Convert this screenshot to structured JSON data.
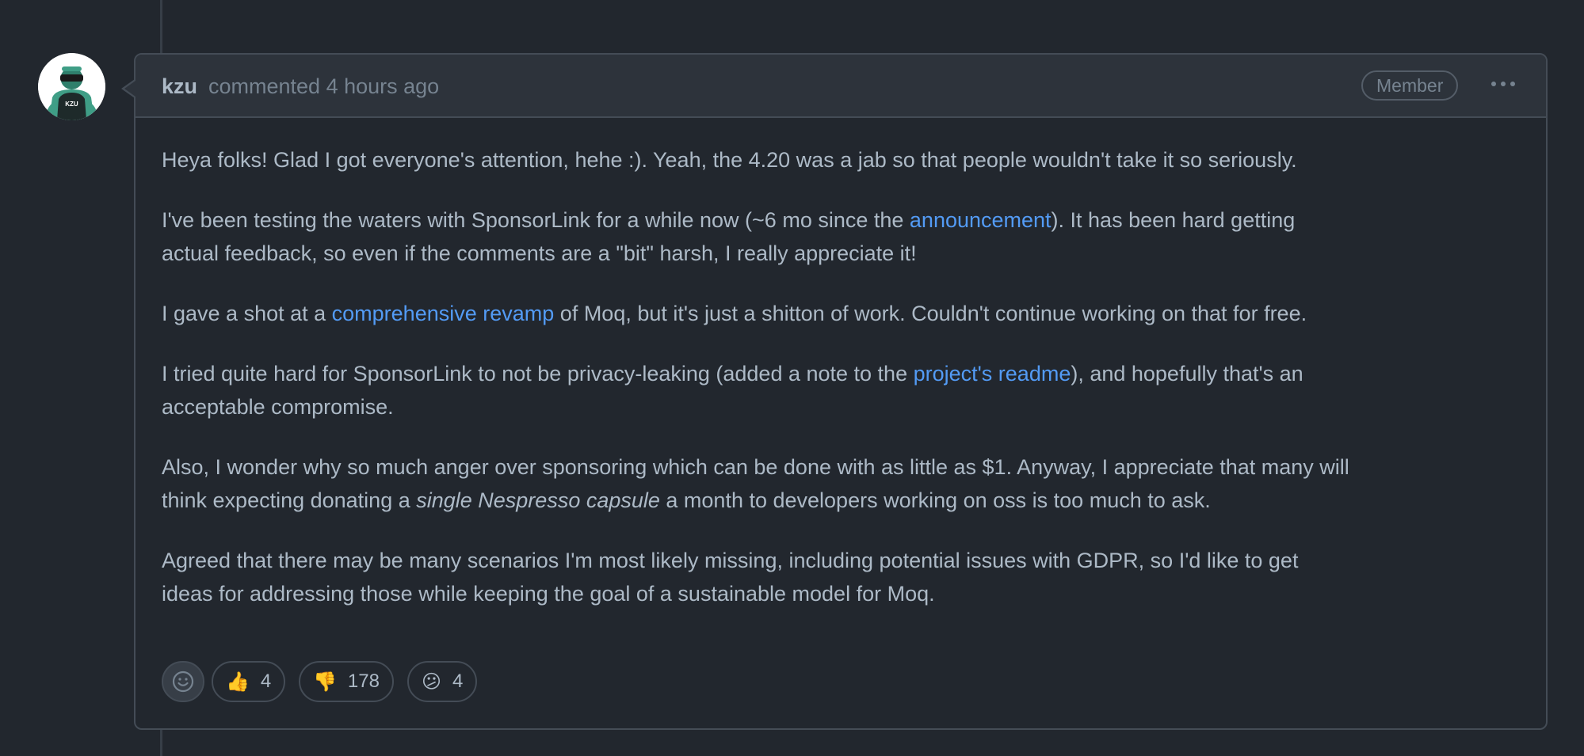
{
  "comment": {
    "author": "kzu",
    "meta": "commented 4 hours ago",
    "badge": "Member",
    "avatar_text": "KZU",
    "body": {
      "p1": "Heya folks! Glad I got everyone's attention, hehe :). Yeah, the 4.20 was a jab so that people wouldn't take it so seriously.",
      "p2_line1_pre": "I've been testing the waters with SponsorLink for a while now (~6 mo since the ",
      "p2_link": "announcement",
      "p2_line1_post": "). It has been hard getting",
      "p2_line2": "actual feedback, so even if the comments are a \"bit\" harsh, I really appreciate it!",
      "p3_pre": "I gave a shot at a ",
      "p3_link": "comprehensive revamp",
      "p3_post": " of Moq, but it's just a shitton of work. Couldn't continue working on that for free.",
      "p4_line1_pre": "I tried quite hard for SponsorLink to not be privacy-leaking (added a note to the ",
      "p4_link": "project's readme",
      "p4_line1_post": "), and hopefully that's an",
      "p4_line2": "acceptable compromise.",
      "p5_line1": "Also, I wonder why so much anger over sponsoring which can be done with as little as $1. Anyway, I appreciate that many will",
      "p5_line2_pre": "think expecting donating a ",
      "p5_em": "single Nespresso capsule",
      "p5_line2_post": " a month to developers working on oss is too much to ask.",
      "p6_line1": "Agreed that there may be many scenarios I'm most likely missing, including potential issues with GDPR, so I'd like to get",
      "p6_line2": "ideas for addressing those while keeping the goal of a sustainable model for Moq."
    },
    "reactions": [
      {
        "icon": "thumbs-up-icon",
        "emoji": "👍",
        "count": "4"
      },
      {
        "icon": "thumbs-down-icon",
        "emoji": "👎",
        "count": "178"
      },
      {
        "icon": "confused-face-icon",
        "emoji": "😕",
        "count": "4"
      }
    ]
  },
  "colors": {
    "background": "#22272e",
    "header": "#2d333b",
    "border": "#444c56",
    "link": "#539bf5",
    "text": "#adbac7",
    "muted": "#768390"
  }
}
